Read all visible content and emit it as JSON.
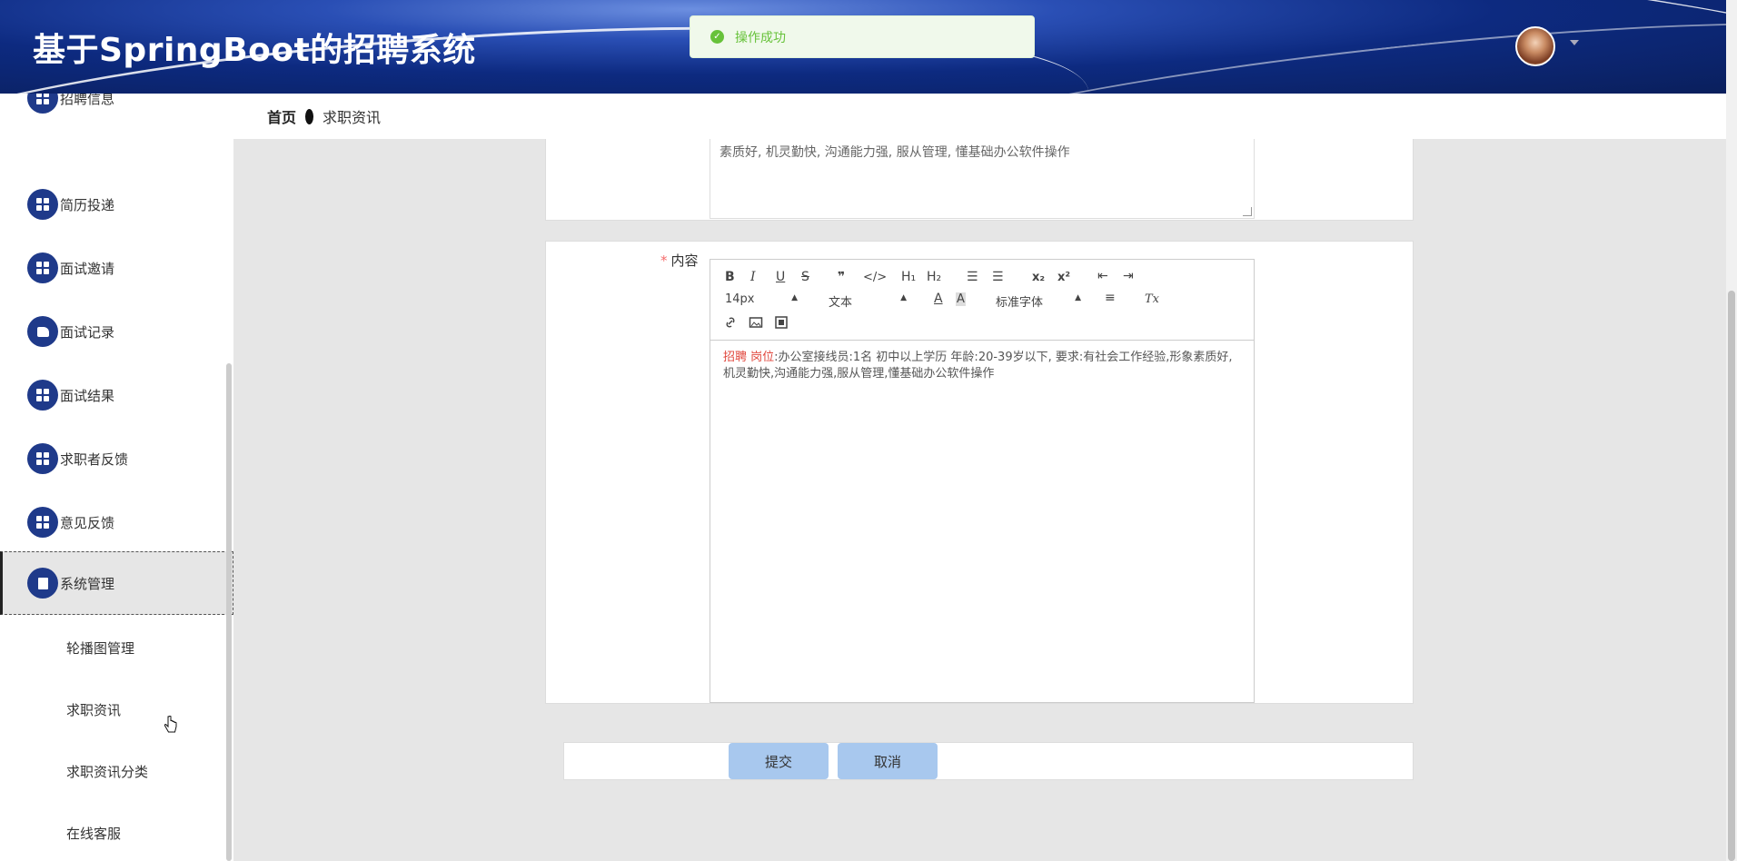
{
  "header": {
    "title": "基于SpringBoot的招聘系统"
  },
  "toast": {
    "message": "操作成功",
    "icon": "check-circle-icon",
    "color": "#67c23a"
  },
  "breadcrumb": {
    "home": "首页",
    "current": "求职资讯"
  },
  "sidebar": {
    "items": [
      {
        "label": "招聘信息",
        "icon": "grid-icon"
      },
      {
        "label": "简历投递",
        "icon": "grid-icon"
      },
      {
        "label": "面试邀请",
        "icon": "grid-icon"
      },
      {
        "label": "面试记录",
        "icon": "hand-icon"
      },
      {
        "label": "面试结果",
        "icon": "grid-icon"
      },
      {
        "label": "求职者反馈",
        "icon": "grid-icon"
      },
      {
        "label": "意见反馈",
        "icon": "grid-icon"
      },
      {
        "label": "系统管理",
        "icon": "clipboard-check-icon",
        "active": true
      }
    ],
    "subitems": [
      {
        "label": "轮播图管理"
      },
      {
        "label": "求职资讯"
      },
      {
        "label": "求职资讯分类"
      },
      {
        "label": "在线客服"
      }
    ]
  },
  "form": {
    "description_text": "素质好, 机灵勤快, 沟通能力强, 服从管理, 懂基础办公软件操作",
    "content_label": "内容",
    "required_mark": "*",
    "editor": {
      "toolbar": {
        "bold": "B",
        "italic": "I",
        "underline": "U",
        "strike": "S",
        "quote": "❞",
        "code": "</>",
        "h1": "H₁",
        "h2": "H₂",
        "ordered_list": "☰",
        "bullet_list": "☰",
        "subscript": "x₂",
        "superscript": "x²",
        "outdent": "⇤",
        "indent": "⇥",
        "font_size": "14px",
        "header_select": "文本",
        "font_family": "标准字体",
        "font_color": "A",
        "background_color": "A",
        "align": "≡",
        "clean": "Tx"
      },
      "body_highlight": "招聘 岗位",
      "body_text": ":办公室接线员:1名 初中以上学历 年龄:20-39岁以下, 要求:有社会工作经验,形象素质好,机灵勤快,沟通能力强,服从管理,懂基础办公软件操作"
    },
    "submit_label": "提交",
    "cancel_label": "取消"
  }
}
